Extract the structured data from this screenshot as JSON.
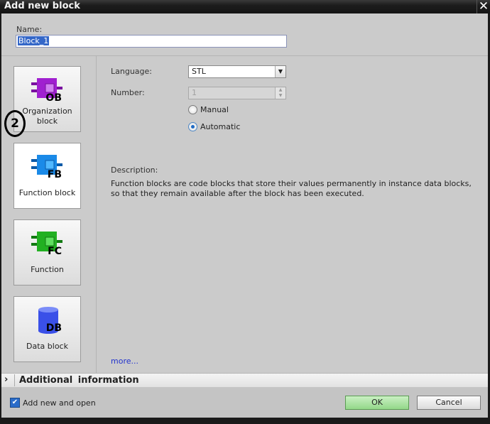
{
  "window": {
    "title": "Add new block",
    "close_icon": "close-icon"
  },
  "name_field": {
    "label": "Name:",
    "value": "Block_1"
  },
  "annotation": {
    "text": "2"
  },
  "block_types": [
    {
      "id": "ob",
      "label_line1": "Organization",
      "label_line2": "block",
      "badge": "OB",
      "color": "#a020d0",
      "icon": "organization-block-icon",
      "selected": false
    },
    {
      "id": "fb",
      "label_line1": "Function block",
      "label_line2": "",
      "badge": "FB",
      "color": "#1a8ae8",
      "icon": "function-block-icon",
      "selected": true
    },
    {
      "id": "fc",
      "label_line1": "Function",
      "label_line2": "",
      "badge": "FC",
      "color": "#22b022",
      "icon": "function-icon",
      "selected": false
    },
    {
      "id": "db",
      "label_line1": "Data block",
      "label_line2": "",
      "badge": "DB",
      "color": "#3a50e8",
      "icon": "data-block-icon",
      "selected": false
    }
  ],
  "settings": {
    "language_label": "Language:",
    "language_value": "STL",
    "number_label": "Number:",
    "number_value": "1",
    "radio_manual": "Manual",
    "radio_automatic": "Automatic",
    "selected_mode": "Automatic"
  },
  "description": {
    "label": "Description:",
    "text": "Function blocks are code blocks that store their values permanently in instance data blocks, so that they remain available after the block has been executed."
  },
  "more_link": "more...",
  "additional_info": {
    "label": "Additional  information",
    "expanded": false
  },
  "footer": {
    "add_new_and_open_label": "Add new and open",
    "add_new_and_open_checked": true,
    "ok_label": "OK",
    "cancel_label": "Cancel"
  }
}
